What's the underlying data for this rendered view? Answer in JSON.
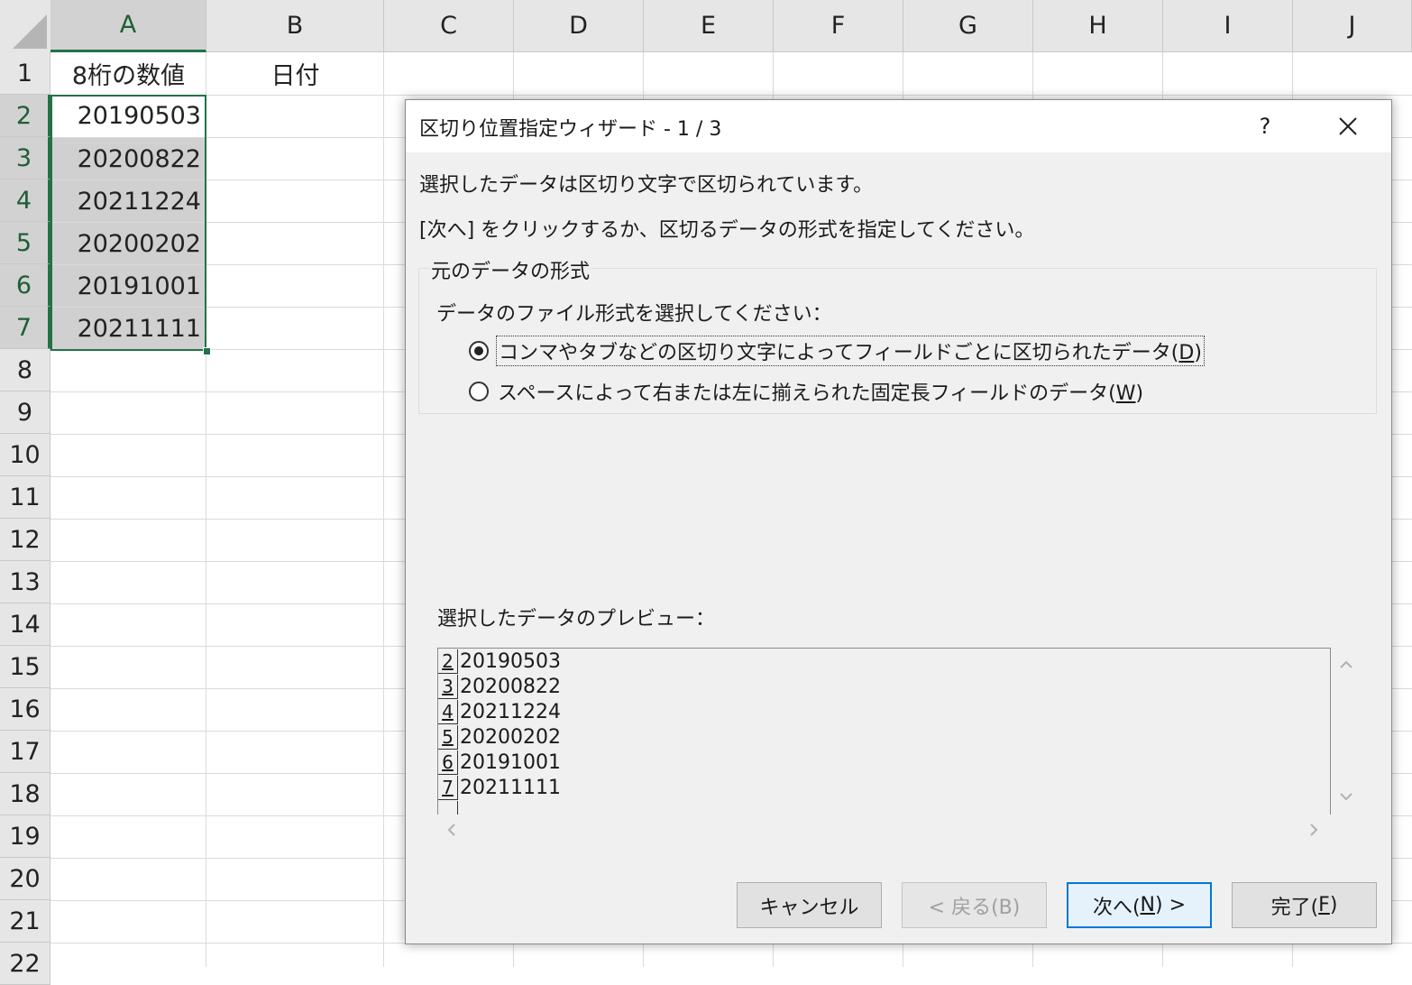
{
  "spreadsheet": {
    "columns": [
      "A",
      "B",
      "C",
      "D",
      "E",
      "F",
      "G",
      "H",
      "I",
      "J"
    ],
    "rows": [
      "1",
      "2",
      "3",
      "4",
      "5",
      "6",
      "7",
      "8",
      "9",
      "10",
      "11",
      "12",
      "13",
      "14",
      "15",
      "16",
      "17",
      "18",
      "19",
      "20",
      "21",
      "22"
    ],
    "cells": {
      "a1": "8桁の数値",
      "b1": "日付",
      "a_values": [
        "20190503",
        "20200822",
        "20211224",
        "20200202",
        "20191001",
        "20211111"
      ]
    }
  },
  "dialog": {
    "title": "区切り位置指定ウィザード - 1 / 3",
    "help": "?",
    "intro_line1": "選択したデータは区切り文字で区切られています。",
    "intro_line2": "[次へ] をクリックするか、区切るデータの形式を指定してください。",
    "group_label": "元のデータの形式",
    "group_prompt": "データのファイル形式を選択してください：",
    "radio_delimited": {
      "label_text": "コンマやタブなどの区切り文字によってフィールドごとに区切られたデータ(",
      "hotkey": "D",
      "label_end": ")",
      "selected": true
    },
    "radio_fixed": {
      "label_text": "スペースによって右または左に揃えられた固定長フィールドのデータ(",
      "hotkey": "W",
      "label_end": ")",
      "selected": false
    },
    "preview_label": "選択したデータのプレビュー：",
    "preview_rows": [
      {
        "num": "2",
        "value": "20190503"
      },
      {
        "num": "3",
        "value": "20200822"
      },
      {
        "num": "4",
        "value": "20211224"
      },
      {
        "num": "5",
        "value": "20200202"
      },
      {
        "num": "6",
        "value": "20191001"
      },
      {
        "num": "7",
        "value": "20211111"
      }
    ],
    "buttons": {
      "cancel": "キャンセル",
      "back": "< 戻る(B)",
      "next_text": "次へ(",
      "next_hotkey": "N",
      "next_end": ") >",
      "finish_text": "完了(",
      "finish_hotkey": "F",
      "finish_end": ")"
    }
  }
}
